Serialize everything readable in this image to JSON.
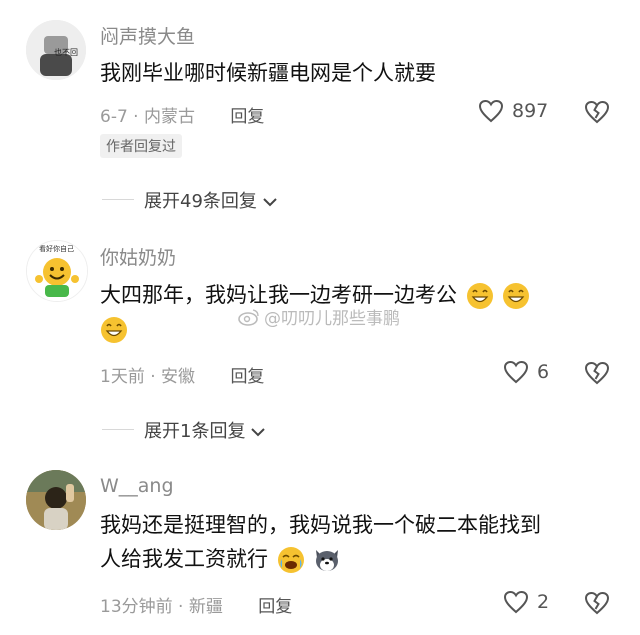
{
  "comments": [
    {
      "username": "闷声摸大鱼",
      "avatar_text": "也不回",
      "text": "我刚毕业哪时候新疆电网是个人就要",
      "meta": "6-7 · 内蒙古",
      "reply_label": "回复",
      "likes": "897",
      "badge": "作者回复过",
      "expand": "展开49条回复"
    },
    {
      "username": "你姑奶奶",
      "avatar_text": "看好你自己",
      "text": "大四那年，我妈让我一边考研一边考公",
      "meta": "1天前 · 安徽",
      "reply_label": "回复",
      "likes": "6",
      "expand": "展开1条回复"
    },
    {
      "username": "W__ang",
      "text_line1": "我妈还是挺理智的，我妈说我一个破二本能找到",
      "text_line2": "人给我发工资就行",
      "meta": "13分钟前 · 新疆",
      "reply_label": "回复",
      "likes": "2"
    }
  ],
  "watermark": "@叨叨儿那些事鹏",
  "icons": {
    "like": "heart-outline-icon",
    "dislike": "broken-heart-icon",
    "expand": "chevron-down-icon",
    "emoji_laugh": "grin-sweat-emoji",
    "emoji_cry": "crying-laughing-emoji",
    "emoji_husky": "husky-emoji"
  },
  "colors": {
    "text": "#111111",
    "muted": "#9a9a9a",
    "icon": "#555555",
    "emoji_yellow": "#f6c230"
  }
}
